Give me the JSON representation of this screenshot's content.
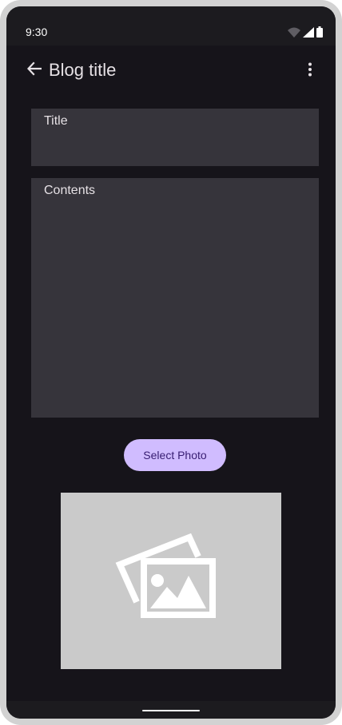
{
  "status_bar": {
    "time": "9:30",
    "icons": [
      "wifi-icon",
      "signal-icon",
      "battery-icon"
    ]
  },
  "app_bar": {
    "title": "Blog title",
    "back_icon": "arrow-back-icon",
    "overflow_icon": "more-vert-icon"
  },
  "form": {
    "title_placeholder": "Title",
    "contents_placeholder": "Contents"
  },
  "actions": {
    "select_photo_label": "Select Photo"
  },
  "image_preview": {
    "icon": "image-placeholder-icon"
  },
  "colors": {
    "background": "#16141a",
    "field": "#36343b",
    "button": "#d0bcff",
    "button_text": "#381e72",
    "placeholder": "#cacaca"
  }
}
